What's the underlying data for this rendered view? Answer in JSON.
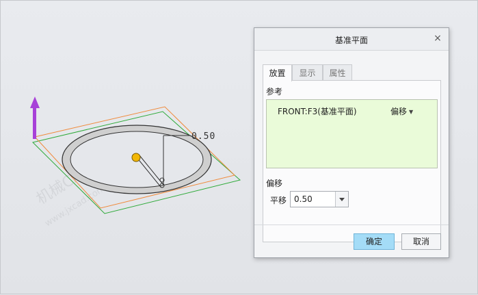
{
  "dialog": {
    "title": "基准平面",
    "close_glyph": "×",
    "tabs": [
      {
        "label": "放置",
        "active": true
      },
      {
        "label": "显示",
        "active": false
      },
      {
        "label": "属性",
        "active": false
      }
    ],
    "references_label": "参考",
    "reference": {
      "name": "FRONT:F3(基准平面)",
      "type": "偏移"
    },
    "offset_label": "偏移",
    "translate_label": "平移",
    "translate_value": "0.50",
    "ok_label": "确定",
    "cancel_label": "取消"
  },
  "viewport": {
    "dimension_label": "0.50",
    "watermark_line1": "机械CAD网",
    "watermark_line2": "www.jxcad.com",
    "colors": {
      "arrow": "#a741d8",
      "front_plane": "#2faa3a",
      "offset_plane": "#f08a3b",
      "ring_fill": "#cfcfcf",
      "ring_stroke": "#333333",
      "center_point": "#f2b705"
    }
  }
}
